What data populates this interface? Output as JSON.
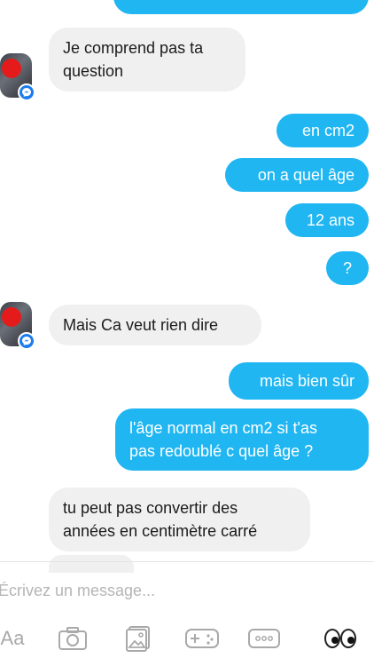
{
  "messages": [
    {
      "from": "them",
      "text": "Je comprend pas ta\nquestion"
    },
    {
      "from": "me",
      "text": "en cm2"
    },
    {
      "from": "me",
      "text": "on a quel âge"
    },
    {
      "from": "me",
      "text": "12 ans"
    },
    {
      "from": "me",
      "text": "?"
    },
    {
      "from": "them",
      "text": "Mais Ca veut rien dire"
    },
    {
      "from": "me",
      "text": "mais bien sûr"
    },
    {
      "from": "me",
      "text": "l'âge normal en cm2 si t'as\npas redoublé c quel âge ?"
    },
    {
      "from": "them",
      "text": "tu peut pas convertir des\nannées en centimètre carré"
    }
  ],
  "composer": {
    "placeholder": "Écrivez un message..."
  },
  "toolbar": {
    "text_button_label": "Aa",
    "icons": [
      "camera-icon",
      "gallery-icon",
      "game-controller-icon",
      "more-icon",
      "eyes-emoji-icon"
    ],
    "eyes_emoji": "👀"
  },
  "colors": {
    "outgoing_bubble": "#1fb6f2",
    "incoming_bubble": "#f0f0f0",
    "messenger_badge": "#1a7cf0"
  }
}
